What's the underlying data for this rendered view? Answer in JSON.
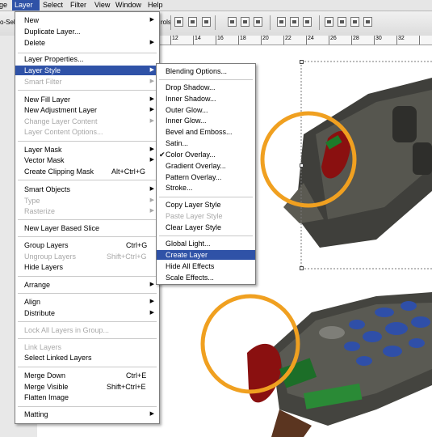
{
  "menubar": {
    "items": [
      {
        "label": "ge",
        "active": false
      },
      {
        "label": "Layer",
        "active": true
      },
      {
        "label": "Select",
        "active": false
      },
      {
        "label": "Filter",
        "active": false
      },
      {
        "label": "View",
        "active": false
      },
      {
        "label": "Window",
        "active": false
      },
      {
        "label": "Help",
        "active": false
      }
    ]
  },
  "options_bar": {
    "left_text": "o-Sel",
    "right_text": "rols"
  },
  "ruler": {
    "labels": [
      "12",
      "14",
      "16",
      "18",
      "20",
      "22",
      "24",
      "26",
      "28",
      "30",
      "32"
    ]
  },
  "layer_menu": {
    "items": [
      {
        "label": "New",
        "submenu": true
      },
      {
        "label": "Duplicate Layer..."
      },
      {
        "label": "Delete",
        "submenu": true
      },
      {
        "label": "Layer Properties..."
      },
      {
        "label": "Layer Style",
        "submenu": true,
        "selected": true
      },
      {
        "label": "Smart Filter",
        "submenu": true,
        "disabled": true
      },
      {
        "label": "New Fill Layer",
        "submenu": true
      },
      {
        "label": "New Adjustment Layer",
        "submenu": true
      },
      {
        "label": "Change Layer Content",
        "submenu": true,
        "disabled": true
      },
      {
        "label": "Layer Content Options...",
        "disabled": true
      },
      {
        "label": "Layer Mask",
        "submenu": true
      },
      {
        "label": "Vector Mask",
        "submenu": true
      },
      {
        "label": "Create Clipping Mask",
        "shortcut": "Alt+Ctrl+G"
      },
      {
        "label": "Smart Objects",
        "submenu": true
      },
      {
        "label": "Type",
        "submenu": true,
        "disabled": true
      },
      {
        "label": "Rasterize",
        "submenu": true,
        "disabled": true
      },
      {
        "label": "New Layer Based Slice"
      },
      {
        "label": "Group Layers",
        "shortcut": "Ctrl+G"
      },
      {
        "label": "Ungroup Layers",
        "shortcut": "Shift+Ctrl+G",
        "disabled": true
      },
      {
        "label": "Hide Layers"
      },
      {
        "label": "Arrange",
        "submenu": true
      },
      {
        "label": "Align",
        "submenu": true
      },
      {
        "label": "Distribute",
        "submenu": true
      },
      {
        "label": "Lock All Layers in Group...",
        "disabled": true
      },
      {
        "label": "Link Layers",
        "disabled": true
      },
      {
        "label": "Select Linked Layers"
      },
      {
        "label": "Merge Down",
        "shortcut": "Ctrl+E"
      },
      {
        "label": "Merge Visible",
        "shortcut": "Shift+Ctrl+E"
      },
      {
        "label": "Flatten Image"
      },
      {
        "label": "Matting",
        "submenu": true
      }
    ]
  },
  "style_menu": {
    "items": [
      {
        "label": "Blending Options..."
      },
      {
        "label": "Drop Shadow..."
      },
      {
        "label": "Inner Shadow..."
      },
      {
        "label": "Outer Glow..."
      },
      {
        "label": "Inner Glow..."
      },
      {
        "label": "Bevel and Emboss..."
      },
      {
        "label": "Satin..."
      },
      {
        "label": "Color Overlay...",
        "checked": true
      },
      {
        "label": "Gradient Overlay..."
      },
      {
        "label": "Pattern Overlay..."
      },
      {
        "label": "Stroke..."
      },
      {
        "label": "Copy Layer Style"
      },
      {
        "label": "Paste Layer Style",
        "disabled": true
      },
      {
        "label": "Clear Layer Style"
      },
      {
        "label": "Global Light..."
      },
      {
        "label": "Create Layer",
        "selected": true
      },
      {
        "label": "Hide All Effects"
      },
      {
        "label": "Scale Effects..."
      }
    ]
  },
  "colors": {
    "highlight": "#2f52a7",
    "circle": "#f0a020",
    "remote_body": "#4a4a45",
    "remote_button": "#2f4fa8",
    "remote_chip": "#8a1010"
  }
}
